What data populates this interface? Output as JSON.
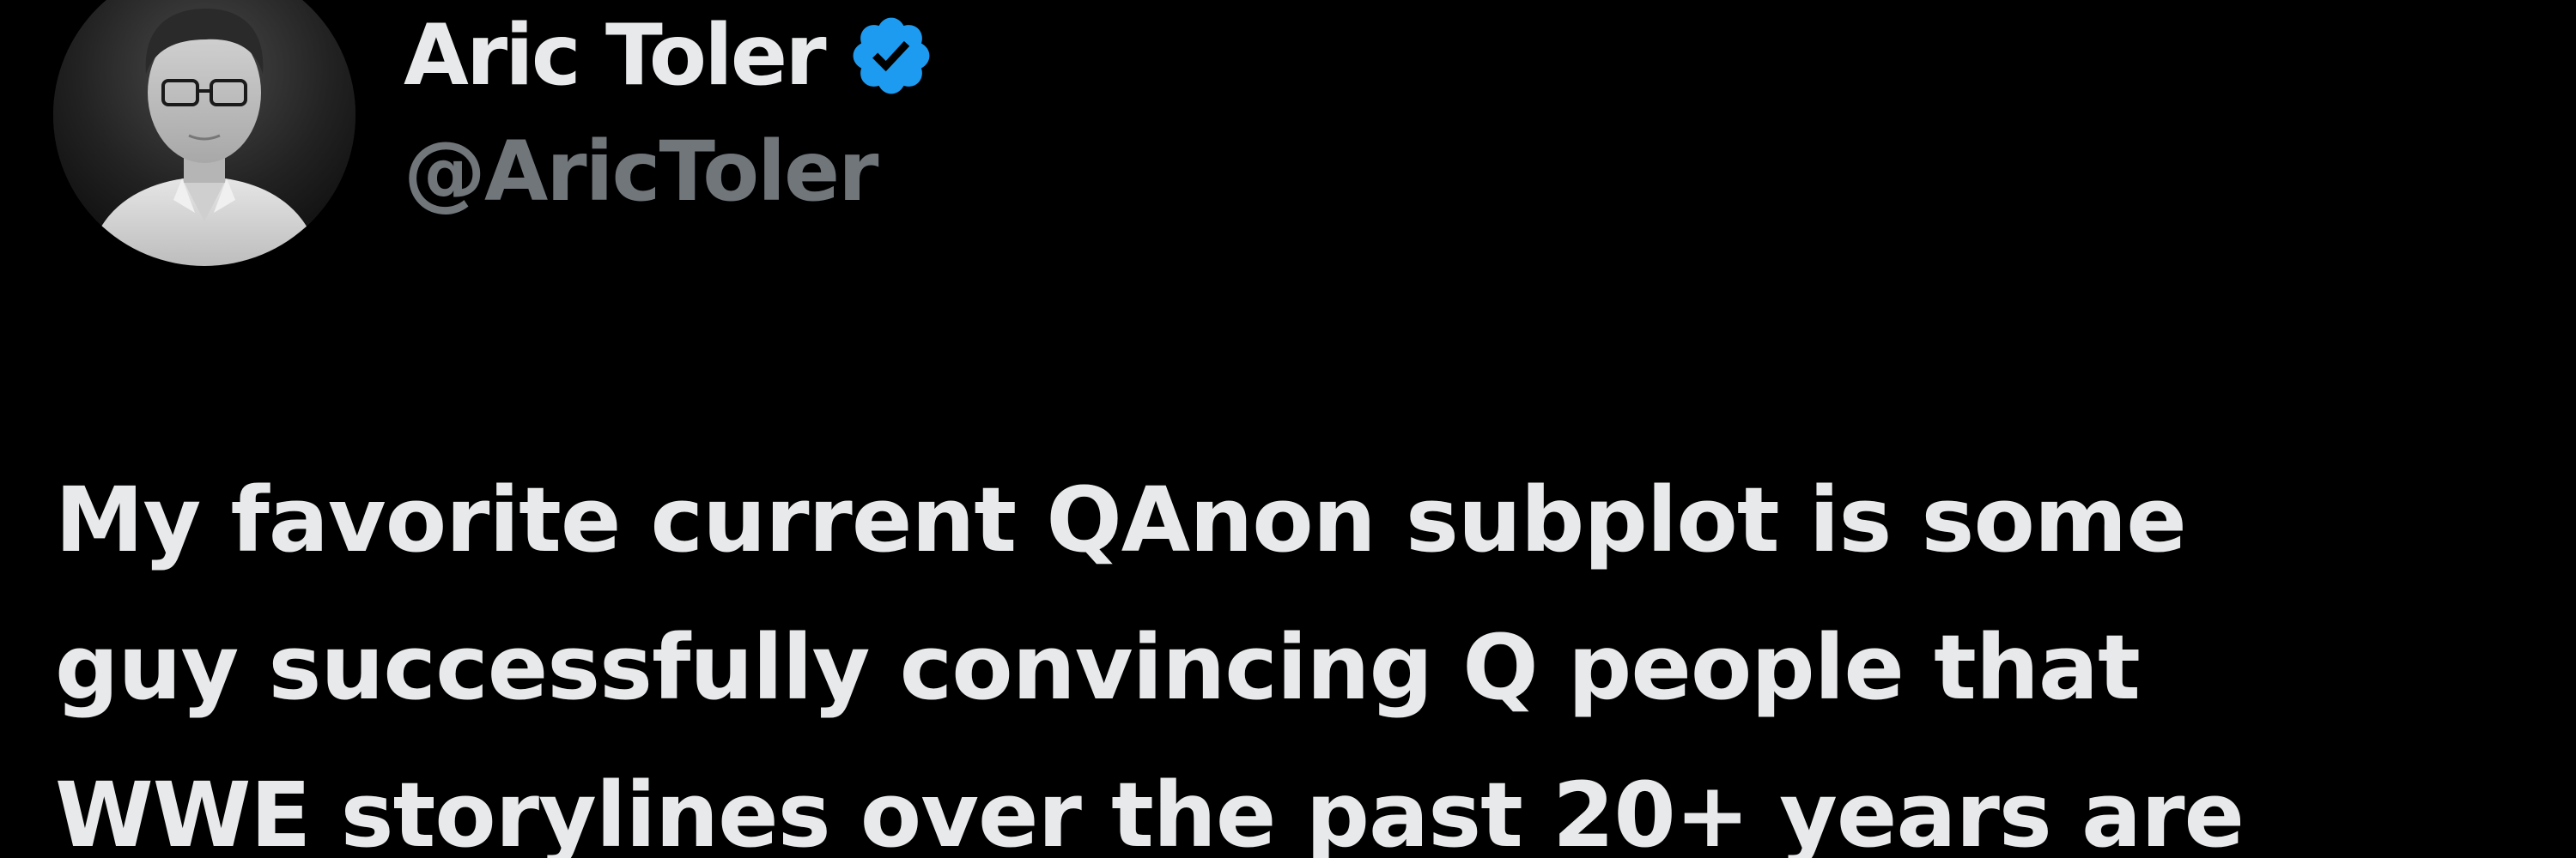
{
  "author": {
    "display_name": "Aric Toler",
    "handle": "@AricToler",
    "verified": true,
    "avatar_icon": "profile-photo"
  },
  "tweet": {
    "lines": [
      "My favorite current QAnon subplot is some",
      "guy successfully convincing Q people that",
      "WWE storylines over the past 20+ years are"
    ]
  },
  "colors": {
    "background": "#000000",
    "primary_text": "#e7e9ea",
    "secondary_text": "#71767b",
    "verified_badge": "#1d9bf0"
  },
  "icons": {
    "verified": "verified-badge-icon"
  }
}
